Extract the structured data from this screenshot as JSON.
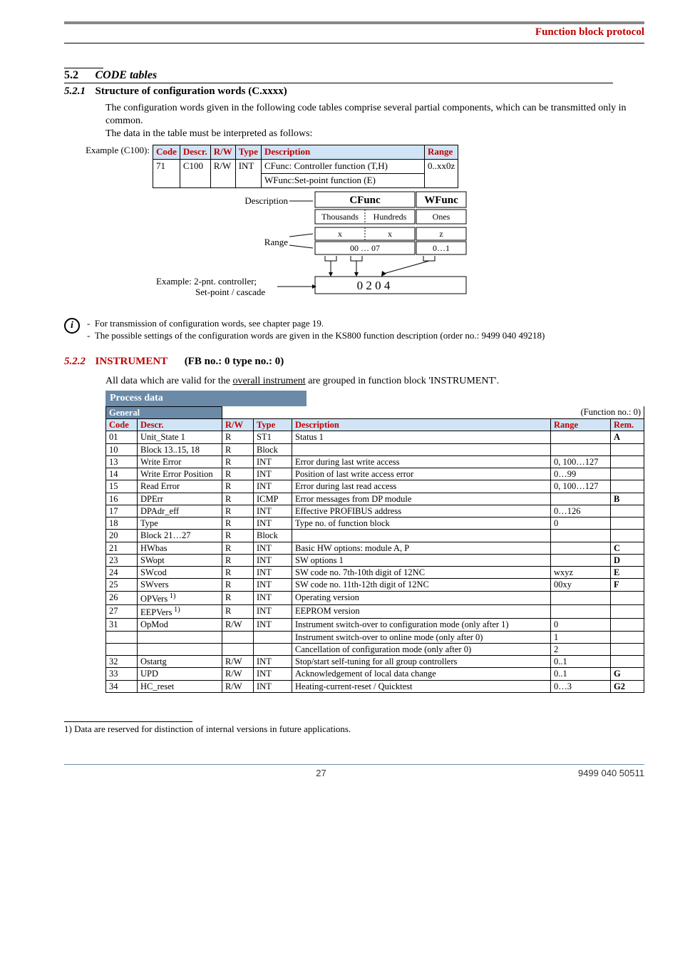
{
  "header": {
    "title": "Function block protocol"
  },
  "sec52": {
    "num": "5.2",
    "title": "CODE tables",
    "s521": {
      "num": "5.2.1",
      "title": "Structure of configuration words (C.xxxx)",
      "para1": "The configuration words given in the following code tables comprise several partial components, which can be transmitted only in common.",
      "para2": "The data in the table must be interpreted as follows:",
      "example_label": "Example (C100):",
      "tbl": {
        "h": [
          "Code",
          "Descr.",
          "R/W",
          "Type",
          "Description",
          "Range"
        ],
        "r": [
          "71",
          "C100",
          "R/W",
          "INT",
          "CFunc:  Controller function  (T,H)",
          "0..xx0z"
        ],
        "r2desc": "WFunc:Set-point function          (E)"
      },
      "diagram": {
        "description_lbl": "Description",
        "range_lbl": "Range",
        "cfunc": "CFunc",
        "wfunc": "WFunc",
        "th": "Thousands",
        "hu": "Hundreds",
        "on": "Ones",
        "x1": "x",
        "x2": "x",
        "z": "z",
        "r1": "00 … 07",
        "r2": "0…1",
        "example_note1": "Example: 2-pnt. controller;",
        "example_note2": "Set-point / cascade",
        "result": "0  2  0  4"
      },
      "info": [
        "For transmission of configuration words, see chapter  page 19.",
        "The possible settings of the configuration words are given in the KS800 function description (order no.: 9499 040 49218)"
      ]
    },
    "s522": {
      "num": "5.2.2",
      "title_part1": "INSTRUMENT",
      "title_part2": "(FB no.: 0     type no.: 0)",
      "intro_a": "All data which are valid for the ",
      "intro_u": "overall instrument",
      "intro_b": " are grouped in function block 'INSTRUMENT'.",
      "process_data": "Process data",
      "general": "General",
      "func_no": "(Function no.: 0)",
      "headers": [
        "Code",
        "Descr.",
        "R/W",
        "Type",
        "Description",
        "Range",
        "Rem."
      ],
      "rows": [
        {
          "c": "01",
          "d": "Unit_State 1",
          "rw": "R",
          "t": "ST1",
          "desc": "Status 1",
          "rng": "",
          "rem": "A"
        },
        {
          "c": "10",
          "d": "Block 13..15, 18",
          "rw": "R",
          "t": "Block",
          "desc": "",
          "rng": "",
          "rem": ""
        },
        {
          "c": "13",
          "d": "Write Error",
          "rw": "R",
          "t": "INT",
          "desc": "Error during last write access",
          "rng": "0, 100…127",
          "rem": ""
        },
        {
          "c": "14",
          "d": "Write Error Position",
          "rw": "R",
          "t": "INT",
          "desc": "Position of last write access error",
          "rng": "0…99",
          "rem": ""
        },
        {
          "c": "15",
          "d": "Read Error",
          "rw": "R",
          "t": "INT",
          "desc": "Error during last read access",
          "rng": "0, 100…127",
          "rem": ""
        },
        {
          "c": "16",
          "d": "DPErr",
          "rw": "R",
          "t": "ICMP",
          "desc": "Error messages from DP module",
          "rng": "",
          "rem": "B"
        },
        {
          "c": "17",
          "d": "DPAdr_eff",
          "rw": "R",
          "t": "INT",
          "desc": "Effective PROFIBUS address",
          "rng": "0…126",
          "rem": ""
        },
        {
          "c": "18",
          "d": "Type",
          "rw": "R",
          "t": "INT",
          "desc": "Type no. of function block",
          "rng": "0",
          "rem": ""
        },
        {
          "c": "20",
          "d": "Block 21…27",
          "rw": "R",
          "t": "Block",
          "desc": "",
          "rng": "",
          "rem": ""
        },
        {
          "c": "21",
          "d": "HWbas",
          "rw": "R",
          "t": "INT",
          "desc": "Basic HW options: module A, P",
          "rng": "",
          "rem": "C"
        },
        {
          "c": "23",
          "d": "SWopt",
          "rw": "R",
          "t": "INT",
          "desc": "SW options 1",
          "rng": "",
          "rem": "D"
        },
        {
          "c": "24",
          "d": "SWcod",
          "rw": "R",
          "t": "INT",
          "desc": "SW code no. 7th-10th digit of 12NC",
          "rng": "wxyz",
          "rem": "E"
        },
        {
          "c": "25",
          "d": "SWvers",
          "rw": "R",
          "t": "INT",
          "desc": "SW code no. 11th-12th digit of 12NC",
          "rng": "00xy",
          "rem": "F"
        },
        {
          "c": "26",
          "d": "OPVers",
          "sup": "1)",
          "rw": "R",
          "t": "INT",
          "desc": "Operating version",
          "rng": "",
          "rem": ""
        },
        {
          "c": "27",
          "d": "EEPVers",
          "sup": "1)",
          "rw": "R",
          "t": "INT",
          "desc": "EEPROM version",
          "rng": "",
          "rem": ""
        },
        {
          "c": "31",
          "d": "OpMod",
          "rw": "R/W",
          "t": "INT",
          "desc": "Instrument switch-over to configuration mode (only after 1)",
          "rng": "0",
          "rem": ""
        },
        {
          "c": "",
          "d": "",
          "rw": "",
          "t": "",
          "desc": "Instrument switch-over to online mode (only after 0)",
          "rng": "1",
          "rem": ""
        },
        {
          "c": "",
          "d": "",
          "rw": "",
          "t": "",
          "desc": "Cancellation of configuration mode (only after 0)",
          "rng": "2",
          "rem": ""
        },
        {
          "c": "32",
          "d": "Ostartg",
          "rw": "R/W",
          "t": "INT",
          "desc": "Stop/start self-tuning for all group controllers",
          "rng": "0..1",
          "rem": ""
        },
        {
          "c": "33",
          "d": "UPD",
          "rw": "R/W",
          "t": "INT",
          "desc": "Acknowledgement of local data change",
          "rng": "0..1",
          "rem": "G"
        },
        {
          "c": "34",
          "d": "HC_reset",
          "rw": "R/W",
          "t": "INT",
          "desc": "Heating-current-reset / Quicktest",
          "rng": "0…3",
          "rem": "G2"
        }
      ]
    }
  },
  "footnote": "1)  Data are reserved for distinction of internal versions in  future applications.",
  "footer": {
    "page": "27",
    "docno": "9499 040 50511"
  }
}
